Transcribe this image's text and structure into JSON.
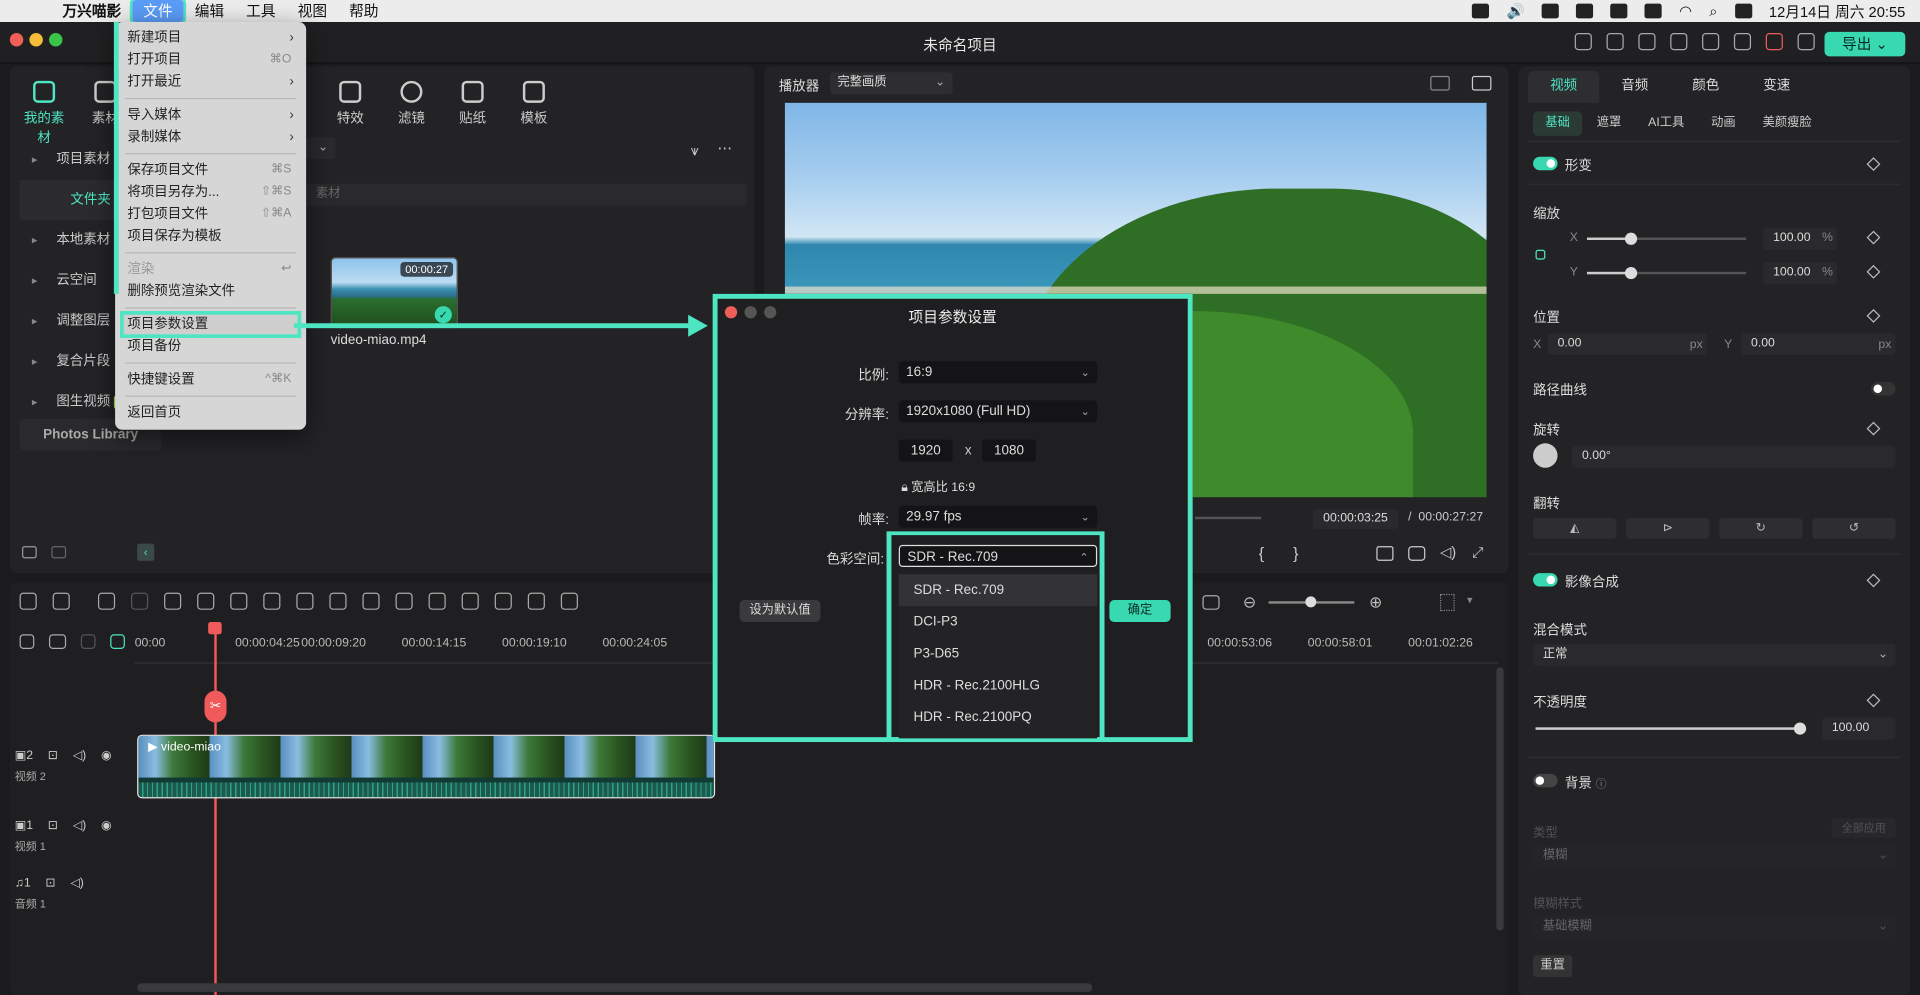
{
  "menubar": {
    "app": "万兴喵影",
    "items": [
      "文件",
      "编辑",
      "工具",
      "视图",
      "帮助"
    ],
    "clock": "12月14日 周六 20:55"
  },
  "window": {
    "title": "未命名项目",
    "export": "导出"
  },
  "media_panel": {
    "tabs": [
      "我的素材",
      "素材",
      "特效",
      "滤镜",
      "贴纸",
      "模板"
    ],
    "tree": [
      "项目素材",
      "文件夹",
      "本地素材",
      "云空间",
      "调整图层",
      "复合片段",
      "图生视频"
    ],
    "ai_badge": "AI",
    "photos_library": "Photos Library",
    "search_placeholder": "素材",
    "clip": {
      "name": "video-miao.mp4",
      "duration": "00:00:27"
    }
  },
  "file_menu": {
    "items": [
      {
        "label": "新建项目",
        "shortcut": "",
        "submenu": true
      },
      {
        "label": "打开项目",
        "shortcut": "⌘O"
      },
      {
        "label": "打开最近",
        "shortcut": "",
        "submenu": true
      },
      {
        "label": "导入媒体",
        "shortcut": "",
        "submenu": true
      },
      {
        "label": "录制媒体",
        "shortcut": "",
        "submenu": true
      },
      {
        "label": "保存项目文件",
        "shortcut": "⌘S"
      },
      {
        "label": "将项目另存为...",
        "shortcut": "⇧⌘S"
      },
      {
        "label": "打包项目文件",
        "shortcut": "⇧⌘A"
      },
      {
        "label": "项目保存为模板",
        "shortcut": ""
      },
      {
        "label": "渲染",
        "shortcut": "↩",
        "disabled": true
      },
      {
        "label": "删除预览渲染文件",
        "shortcut": ""
      },
      {
        "label": "项目参数设置",
        "shortcut": "",
        "highlight": true
      },
      {
        "label": "项目备份",
        "shortcut": ""
      },
      {
        "label": "快捷键设置",
        "shortcut": "^⌘K"
      },
      {
        "label": "返回首页",
        "shortcut": ""
      }
    ]
  },
  "player": {
    "label": "播放器",
    "quality": "完整画质",
    "current_time": "00:00:03:25",
    "separator": "/",
    "total_time": "00:00:27:27",
    "brace_open": "{",
    "brace_close": "}"
  },
  "dialog": {
    "title": "项目参数设置",
    "ratio_label": "比例:",
    "ratio_value": "16:9",
    "resolution_label": "分辨率:",
    "resolution_value": "1920x1080 (Full HD)",
    "width": "1920",
    "x": "x",
    "height": "1080",
    "aspect_lock": "宽高比 16:9",
    "framerate_label": "帧率:",
    "framerate_value": "29.97 fps",
    "colorspace_label": "色彩空间:",
    "colorspace_value": "SDR - Rec.709",
    "colorspace_options": [
      "SDR - Rec.709",
      "DCI-P3",
      "P3-D65",
      "HDR - Rec.2100HLG",
      "HDR - Rec.2100PQ"
    ],
    "default_btn": "设为默认值",
    "ok_btn": "确定"
  },
  "inspector": {
    "tabs": [
      "视频",
      "音频",
      "颜色",
      "变速"
    ],
    "subtabs": [
      "基础",
      "遮罩",
      "AI工具",
      "动画",
      "美颜瘦脸"
    ],
    "transform": "形变",
    "scale": "缩放",
    "x_label": "X",
    "y_label": "Y",
    "scale_x": "100.00",
    "scale_y": "100.00",
    "scale_x_level": 0.28,
    "scale_y_level": 0.28,
    "percent": "%",
    "position": "位置",
    "pos_x": "0.00",
    "pos_y": "0.00",
    "px": "px",
    "path_curve": "路径曲线",
    "rotate": "旋转",
    "rotate_value": "0.00°",
    "flip": "翻转",
    "composite": "影像合成",
    "blend_mode": "混合模式",
    "blend_value": "正常",
    "opacity": "不透明度",
    "opacity_value": "100.00",
    "opacity_level": 1.0,
    "background": "背景",
    "type": "类型",
    "apply_all": "全部应用",
    "blur": "模糊",
    "blur_style": "模糊样式",
    "basic_blur": "基础模糊",
    "reset": "重置"
  },
  "timeline": {
    "ruler": [
      "00:00",
      "00:00:04:25",
      "00:00:09:20",
      "00:00:14:15",
      "00:00:19:10",
      "00:00:24:05",
      "00:00:53:06",
      "00:00:58:01",
      "00:01:02:26"
    ],
    "tracks": [
      {
        "num": "2",
        "name": "视频 2"
      },
      {
        "num": "1",
        "name": "视频 1"
      },
      {
        "num": "1",
        "name": "音频 1"
      }
    ],
    "clip_name": "video-miao"
  }
}
